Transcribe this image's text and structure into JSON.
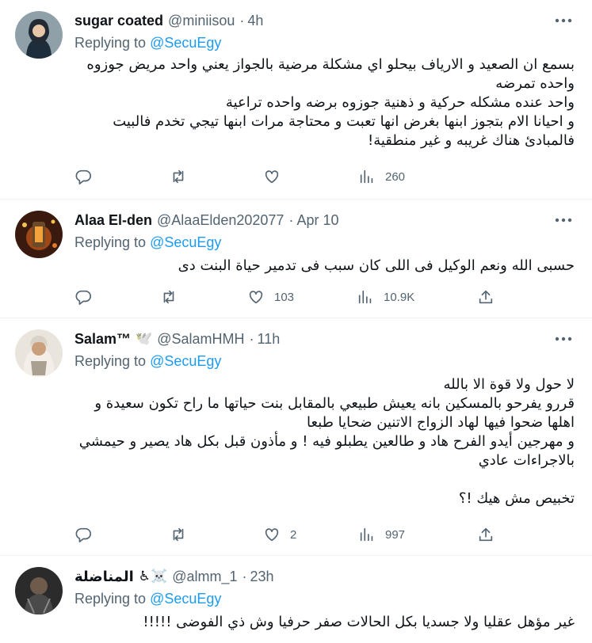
{
  "tweets": [
    {
      "name": "sugar coated",
      "handle": "@miniisou",
      "time": "4h",
      "emoji": "",
      "replying_label": "Replying to",
      "replying_to": "@SecuEgy",
      "body": "بسمع ان الصعيد و الارياف بيحلو اي مشكلة مرضية بالجواز يعني واحد مريض جوزوه\nواحده تمرضه\nواحد عنده مشكله حركية و ذهنية جوزوه برضه واحده تراعية\nو احيانا الام بتجوز ابنها بغرض انها تعبت و محتاجة مرات ابنها تيجي تخدم فالبيت\nفالمبادئ هناك غريبه و غير منطقية!",
      "stats": {
        "replies": "",
        "retweets": "",
        "likes": "",
        "views": "260"
      }
    },
    {
      "name": "Alaa El-den",
      "handle": "@AlaaElden202077",
      "time": "Apr 10",
      "emoji": "",
      "replying_label": "Replying to",
      "replying_to": "@SecuEgy",
      "body": "حسبى الله ونعم الوكيل فى اللى كان سبب فى تدمير حياة البنت دى",
      "stats": {
        "replies": "",
        "retweets": "",
        "likes": "103",
        "views": "10.9K"
      }
    },
    {
      "name": "Salam™",
      "handle": "@SalamHMH",
      "time": "11h",
      "emoji": "🕊️",
      "replying_label": "Replying to",
      "replying_to": "@SecuEgy",
      "body": "لا حول ولا قوة الا بالله\nقررو يفرحو بالمسكين  بانه يعيش طبيعي بالمقابل بنت حياتها ما راح تكون سعيدة و\nاهلها ضحوا فيها لهاد الزواج الاتنين ضحايا طبعا\nو مهرجين أيدو الفرح هاد  و طالعين يطبلو فيه ! و مأذون قبل بكل هاد يصير و حيمشي\nبالاجراءات عادي\n\nتخبيص مش هيك !؟",
      "stats": {
        "replies": "",
        "retweets": "",
        "likes": "2",
        "views": "997"
      }
    },
    {
      "name": "المناضلة",
      "handle": "@almm_1",
      "time": "23h",
      "emoji": "♿☠️",
      "replying_label": "Replying to",
      "replying_to": "@SecuEgy",
      "body": "غير مؤهل عقليا ولا جسديا بكل الحالات صفر حرفيا وش ذي الفوضى !!!!!",
      "stats": {
        "replies": "",
        "retweets": "",
        "likes": "",
        "views": ""
      }
    }
  ],
  "colors": {
    "accent": "#1d9bf0",
    "muted": "#536471",
    "text": "#0f1419"
  },
  "icons": [
    "reply-icon",
    "retweet-icon",
    "like-icon",
    "views-icon",
    "share-icon",
    "more-icon"
  ]
}
